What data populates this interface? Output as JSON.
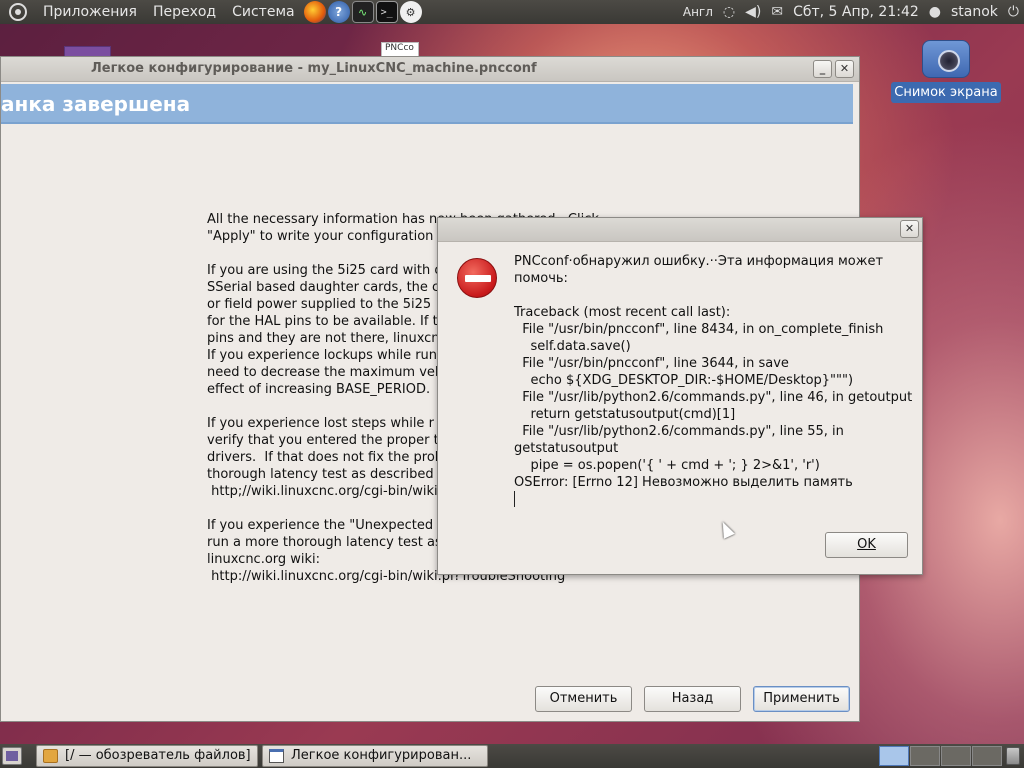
{
  "top_panel": {
    "menus": [
      "Приложения",
      "Переход",
      "Система"
    ],
    "keyboard_layout": "Англ",
    "clock": "Сбт,  5 Апр, 21:42",
    "user": "stanok"
  },
  "desktop": {
    "pncconf_icon_label": "PNCco",
    "screenshot_icon_label": "Снимок экрана"
  },
  "main_window": {
    "title": "Легкое конфигурирование - my_LinuxCNC_machine.pncconf",
    "header": "анка завершена",
    "info_text": "All the necessary information has now been gathered.  Click\n\"Apply\" to write your configuration \n\nIf you are using the 5i25 card with o\nSSerial based daughter cards, the c\nor field power supplied to the 5i25\nfor the HAL pins to be available. If t\npins and they are not there, linuxcn\nIf you experience lockups while run\nneed to decrease the maximum vel\neffect of increasing BASE_PERIOD.\n\nIf you experience lost steps while r\nverify that you entered the proper t\ndrivers.  If that does not fix the prob\nthorough latency test as described \n http;//wiki.linuxcnc.org/cgi-bin/wiki\n\nIf you experience the \"Unexpected\nrun a more thorough latency test as\nlinuxcnc.org wiki:\n http://wiki.linuxcnc.org/cgi-bin/wiki.pl?TroubleShooting",
    "cancel_label": "Отменить",
    "back_label": "Назад",
    "apply_label": "Применить"
  },
  "error_dialog": {
    "message": "PNCconf·обнаружил ошибку.··Эта информация может помочь:\n\nTraceback (most recent call last):\n  File \"/usr/bin/pncconf\", line 8434, in on_complete_finish\n    self.data.save()\n  File \"/usr/bin/pncconf\", line 3644, in save\n    echo ${XDG_DESKTOP_DIR:-$HOME/Desktop}\"\"\")\n  File \"/usr/lib/python2.6/commands.py\", line 46, in getoutput\n    return getstatusoutput(cmd)[1]\n  File \"/usr/lib/python2.6/commands.py\", line 55, in getstatusoutput\n    pipe = os.popen('{ ' + cmd + '; } 2>&1', 'r')\nOSError: [Errno 12] Невозможно выделить память",
    "ok_label": "OK",
    "close_label": "✕"
  },
  "taskbar": {
    "tasks": [
      "[/ — обозреватель файлов]",
      "Легкое конфигурирован..."
    ]
  },
  "icons": {
    "minimize": "_",
    "close": "✕",
    "wifi": "◌",
    "volume": "◀)",
    "mail": "✉",
    "power": "⏻"
  }
}
